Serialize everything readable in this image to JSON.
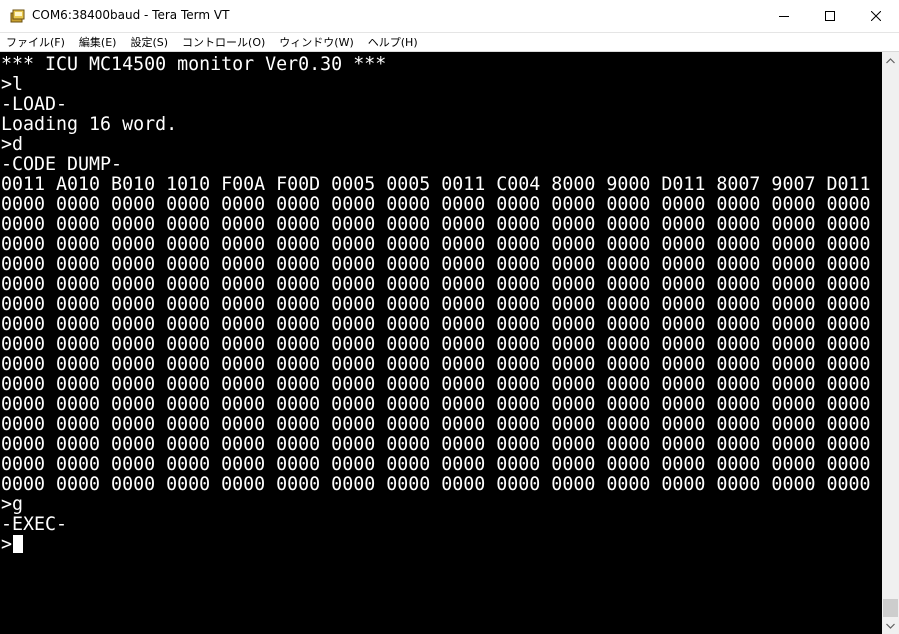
{
  "window": {
    "title": "COM6:38400baud - Tera Term VT"
  },
  "menu": [
    "ファイル(F)",
    "編集(E)",
    "設定(S)",
    "コントロール(O)",
    "ウィンドウ(W)",
    "ヘルプ(H)"
  ],
  "terminal": {
    "lines": [
      "*** ICU MC14500 monitor Ver0.30 ***",
      ">l",
      "-LOAD-",
      "Loading 16 word.",
      ">d",
      "-CODE DUMP-",
      "0011 A010 B010 1010 F00A F00D 0005 0005 0011 C004 8000 9000 D011 8007 9007 D011",
      "0000 0000 0000 0000 0000 0000 0000 0000 0000 0000 0000 0000 0000 0000 0000 0000",
      "0000 0000 0000 0000 0000 0000 0000 0000 0000 0000 0000 0000 0000 0000 0000 0000",
      "0000 0000 0000 0000 0000 0000 0000 0000 0000 0000 0000 0000 0000 0000 0000 0000",
      "0000 0000 0000 0000 0000 0000 0000 0000 0000 0000 0000 0000 0000 0000 0000 0000",
      "0000 0000 0000 0000 0000 0000 0000 0000 0000 0000 0000 0000 0000 0000 0000 0000",
      "0000 0000 0000 0000 0000 0000 0000 0000 0000 0000 0000 0000 0000 0000 0000 0000",
      "0000 0000 0000 0000 0000 0000 0000 0000 0000 0000 0000 0000 0000 0000 0000 0000",
      "0000 0000 0000 0000 0000 0000 0000 0000 0000 0000 0000 0000 0000 0000 0000 0000",
      "0000 0000 0000 0000 0000 0000 0000 0000 0000 0000 0000 0000 0000 0000 0000 0000",
      "0000 0000 0000 0000 0000 0000 0000 0000 0000 0000 0000 0000 0000 0000 0000 0000",
      "0000 0000 0000 0000 0000 0000 0000 0000 0000 0000 0000 0000 0000 0000 0000 0000",
      "0000 0000 0000 0000 0000 0000 0000 0000 0000 0000 0000 0000 0000 0000 0000 0000",
      "0000 0000 0000 0000 0000 0000 0000 0000 0000 0000 0000 0000 0000 0000 0000 0000",
      "0000 0000 0000 0000 0000 0000 0000 0000 0000 0000 0000 0000 0000 0000 0000 0000",
      "0000 0000 0000 0000 0000 0000 0000 0000 0000 0000 0000 0000 0000 0000 0000 0000",
      ">g",
      "-EXEC-",
      ">"
    ],
    "foreground": "#ffffff",
    "background": "#000000"
  }
}
